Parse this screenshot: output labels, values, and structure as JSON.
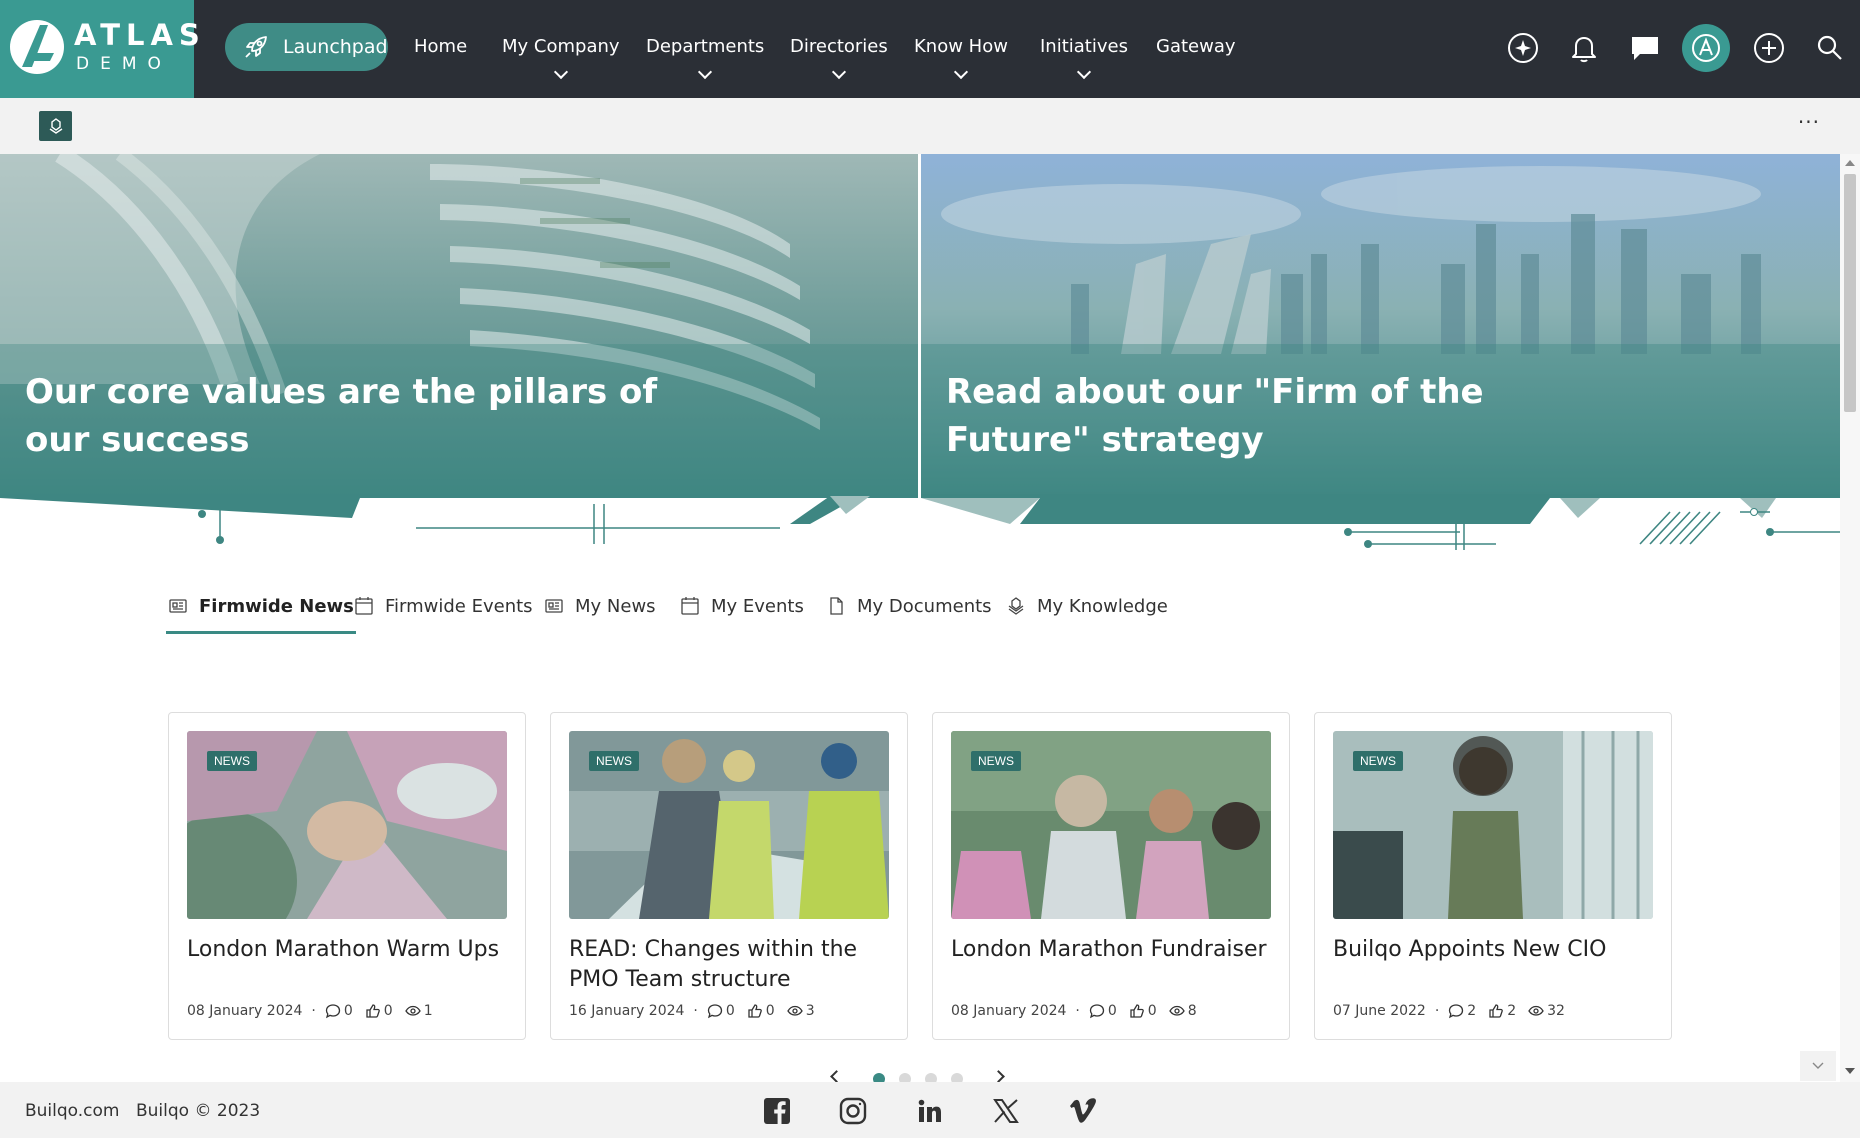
{
  "brand": {
    "name": "ATLAS",
    "sub": "DEMO",
    "color": "#3a9a92"
  },
  "nav": {
    "launchpad": "Launchpad",
    "items": [
      {
        "label": "Home",
        "dropdown": false
      },
      {
        "label": "My Company",
        "dropdown": true
      },
      {
        "label": "Departments",
        "dropdown": true
      },
      {
        "label": "Directories",
        "dropdown": true
      },
      {
        "label": "Know How",
        "dropdown": true
      },
      {
        "label": "Initiatives",
        "dropdown": true
      },
      {
        "label": "Gateway",
        "dropdown": false
      }
    ],
    "icons": [
      "sparkle-icon",
      "bell-icon",
      "chat-icon",
      "atlas-avatar-icon",
      "add-circle-icon",
      "search-icon"
    ]
  },
  "subbar": {
    "more": "···"
  },
  "hero": [
    {
      "title": "Our core values are the pillars of our success"
    },
    {
      "title": "Read about our \"Firm of the Future\" strategy"
    }
  ],
  "tabs": [
    {
      "label": "Firmwide News",
      "icon": "news-icon",
      "active": true
    },
    {
      "label": "Firmwide Events",
      "icon": "calendar-icon",
      "active": false
    },
    {
      "label": "My News",
      "icon": "news-icon",
      "active": false
    },
    {
      "label": "My Events",
      "icon": "calendar-icon",
      "active": false
    },
    {
      "label": "My Documents",
      "icon": "document-icon",
      "active": false
    },
    {
      "label": "My Knowledge",
      "icon": "knowledge-icon",
      "active": false
    }
  ],
  "cards": [
    {
      "badge": "NEWS",
      "title": "London Marathon Warm Ups",
      "date": "08 January 2024",
      "comments": "0",
      "likes": "0",
      "views": "1"
    },
    {
      "badge": "NEWS",
      "title": "READ: Changes within the PMO Team structure",
      "date": "16 January 2024",
      "comments": "0",
      "likes": "0",
      "views": "3"
    },
    {
      "badge": "NEWS",
      "title": "London Marathon Fundraiser",
      "date": "08 January 2024",
      "comments": "0",
      "likes": "0",
      "views": "8"
    },
    {
      "badge": "NEWS",
      "title": "Builqo Appoints New CIO",
      "date": "07 June 2022",
      "comments": "2",
      "likes": "2",
      "views": "32"
    }
  ],
  "pager": {
    "pages": 4,
    "current": 1
  },
  "footer": {
    "link": "Builqo.com",
    "copyright": "Builqo © 2023",
    "social": [
      "facebook-icon",
      "instagram-icon",
      "linkedin-icon",
      "x-icon",
      "vimeo-icon"
    ]
  },
  "colors": {
    "topbar": "#2b2f36",
    "accent": "#3a9a92",
    "teal_dark": "#2f6f6a"
  }
}
